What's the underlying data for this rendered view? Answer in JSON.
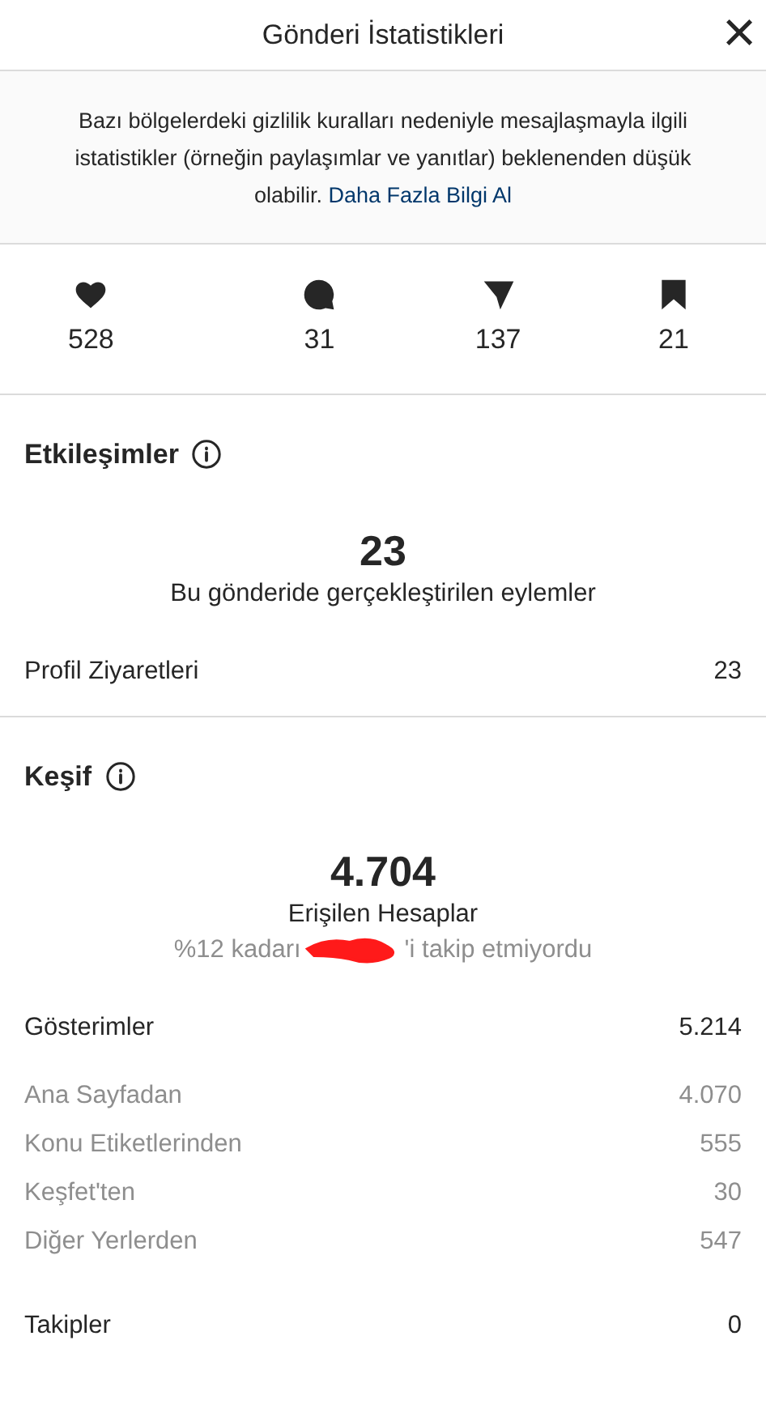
{
  "header": {
    "title": "Gönderi İstatistikleri",
    "close": "×"
  },
  "notice": {
    "text": "Bazı bölgelerdeki gizlilik kuralları nedeniyle mesajlaşmayla ilgili istatistikler (örneğin paylaşımlar ve yanıtlar) beklenenden düşük olabilir.",
    "link": "Daha Fazla Bilgi Al"
  },
  "stats": [
    {
      "kind": "like",
      "value": "528"
    },
    {
      "kind": "comment",
      "value": "31"
    },
    {
      "kind": "share",
      "value": "137"
    },
    {
      "kind": "save",
      "value": "21"
    }
  ],
  "sections": [
    {
      "title": "Etkileşimler",
      "big_number": "23",
      "big_label": "Bu gönderide gerçekleştirilen eylemler",
      "rows": [
        {
          "kind": "primary",
          "label": "Profil Ziyaretleri",
          "value": "23"
        }
      ]
    },
    {
      "title": "Keşif",
      "big_number": "4.704",
      "big_label": "Erişilen Hesaplar",
      "note_before": "%12 kadarı",
      "note_after": "'i takip etmiyordu",
      "rows": [
        {
          "kind": "primary",
          "label": "Gösterimler",
          "value": "5.214"
        },
        {
          "kind": "secondary",
          "label": "Ana Sayfadan",
          "value": "4.070"
        },
        {
          "kind": "secondary",
          "label": "Konu Etiketlerinden",
          "value": "555"
        },
        {
          "kind": "secondary",
          "label": "Keşfet'ten",
          "value": "30"
        },
        {
          "kind": "secondary",
          "label": "Diğer Yerlerden",
          "value": "547"
        },
        {
          "kind": "primary",
          "label": "Takipler",
          "value": "0"
        }
      ]
    }
  ]
}
